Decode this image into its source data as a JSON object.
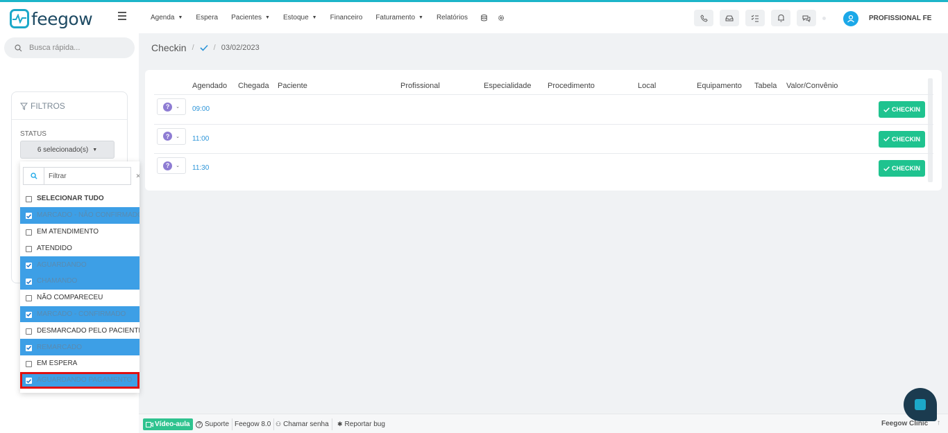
{
  "brand": {
    "name": "feegow",
    "color": "#1ca8c9"
  },
  "nav": {
    "items": [
      {
        "label": "Agenda",
        "caret": true
      },
      {
        "label": "Espera",
        "caret": false
      },
      {
        "label": "Pacientes",
        "caret": true
      },
      {
        "label": "Estoque",
        "caret": true
      },
      {
        "label": "Financeiro",
        "caret": false
      },
      {
        "label": "Faturamento",
        "caret": true
      },
      {
        "label": "Relatórios",
        "caret": false
      }
    ],
    "icons": [
      "database-icon",
      "gear-icon"
    ]
  },
  "header": {
    "buttons": [
      "phone-icon",
      "inbox-icon",
      "checklist-icon",
      "bell-icon",
      "chat-icon"
    ],
    "user_name": "PROFISSIONAL FE"
  },
  "search": {
    "placeholder": "Busca rápida..."
  },
  "filters": {
    "title": "FILTROS",
    "status_label": "STATUS",
    "status_selected": "6 selecionado(s)",
    "dropdown": {
      "filter_placeholder": "Filtrar",
      "items": [
        {
          "label": "SELECIONAR TUDO",
          "checked": false,
          "bold": true
        },
        {
          "label": "MARCADO - NÃO CONFIRMADO",
          "checked": true
        },
        {
          "label": "EM ATENDIMENTO",
          "checked": false
        },
        {
          "label": "ATENDIDO",
          "checked": false
        },
        {
          "label": "AGUARDANDO",
          "checked": true
        },
        {
          "label": "CHAMANDO",
          "checked": true
        },
        {
          "label": "NÃO COMPARECEU",
          "checked": false
        },
        {
          "label": "MARCADO - CONFIRMADO",
          "checked": true
        },
        {
          "label": "DESMARCADO PELO PACIENTE",
          "checked": false
        },
        {
          "label": "REMARCADO",
          "checked": true
        },
        {
          "label": "EM ESPERA",
          "checked": false
        },
        {
          "label": "AGUARDANDO PAGAMENTO",
          "checked": true,
          "highlight": true
        }
      ]
    }
  },
  "breadcrumb": {
    "title": "Checkin",
    "separator": "/",
    "date": "03/02/2023"
  },
  "table": {
    "headers": [
      "Agendado",
      "Chegada",
      "Paciente",
      "Profissional",
      "Especialidade",
      "Procedimento",
      "Local",
      "Equipamento",
      "Tabela",
      "Valor/Convênio"
    ],
    "rows": [
      {
        "time": "09:00",
        "action": "CHECKIN"
      },
      {
        "time": "11:00",
        "action": "CHECKIN"
      },
      {
        "time": "11:30",
        "action": "CHECKIN"
      }
    ]
  },
  "footer": {
    "video": "Vídeo-aula",
    "items": [
      "Suporte",
      "Feegow 8.0",
      "Chamar senha",
      "Reportar bug"
    ],
    "brand": "Feegow Clinic"
  }
}
